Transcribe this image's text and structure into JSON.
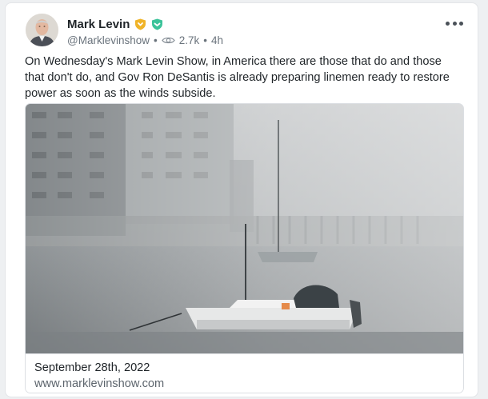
{
  "post": {
    "author_name": "Mark Levin",
    "handle": "@Marklevinshow",
    "separator": "•",
    "views": "2.7k",
    "time": "4h",
    "text": "On Wednesday's Mark Levin Show, in America there are those that do and those that don't do, and Gov Ron DeSantis is already preparing linemen ready to restore power as soon as the winds subside."
  },
  "badges": [
    {
      "icon": "gold-shield-badge-icon",
      "color": "#f0b429"
    },
    {
      "icon": "green-shield-badge-icon",
      "color": "#3cc39a"
    }
  ],
  "link_card": {
    "date": "September 28th, 2022",
    "domain": "www.marklevinshow.com",
    "image_description_icon": "stormy-harbor-sailboat-image"
  }
}
